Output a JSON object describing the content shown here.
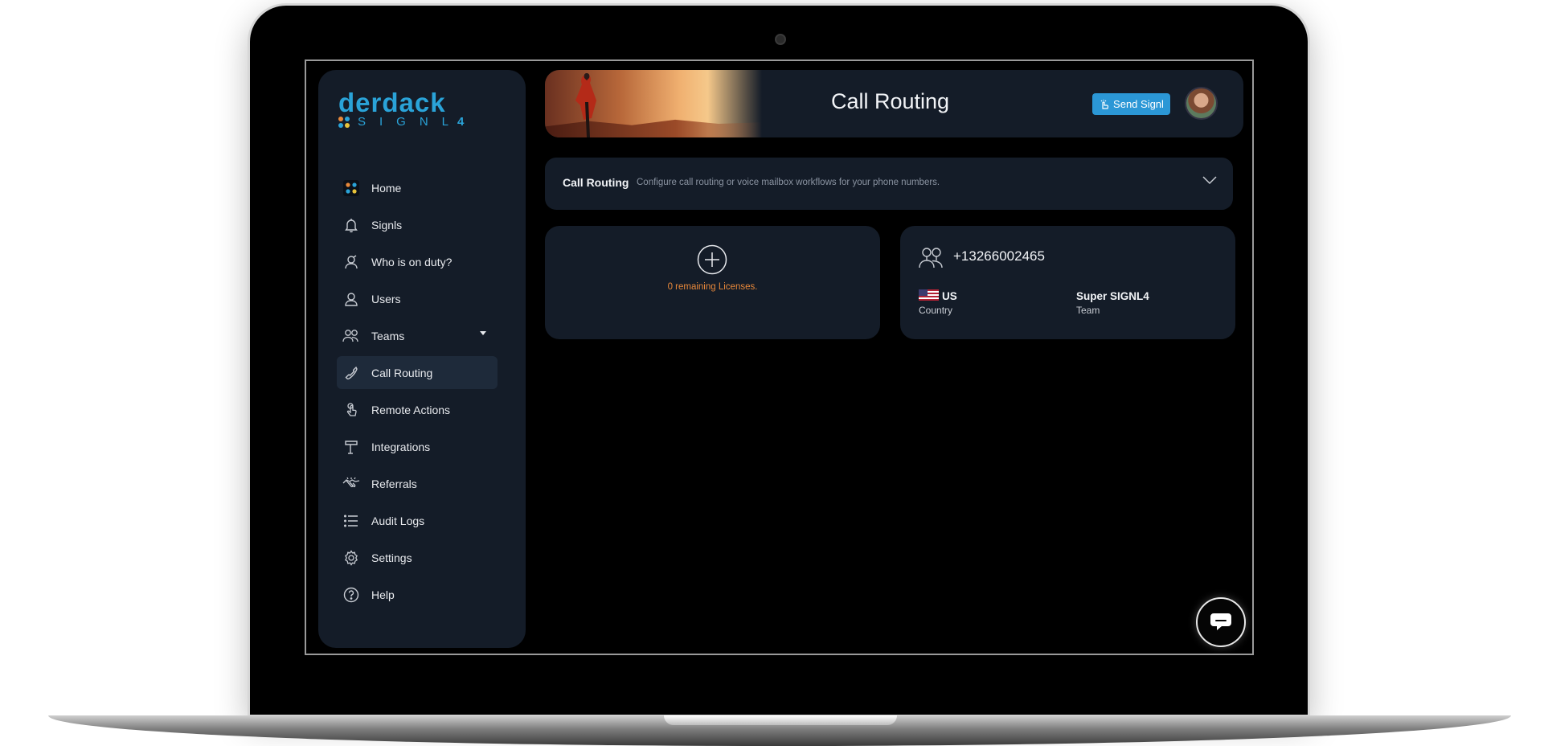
{
  "brand": {
    "word": "derdack",
    "sub": "SIGNL",
    "sub_num": "4"
  },
  "nav": [
    {
      "label": "Home",
      "icon": "home-grid-icon"
    },
    {
      "label": "Signls",
      "icon": "bell-icon"
    },
    {
      "label": "Who is on duty?",
      "icon": "duty-user-icon"
    },
    {
      "label": "Users",
      "icon": "user-icon"
    },
    {
      "label": "Teams",
      "icon": "team-icon",
      "has_dropdown": true
    },
    {
      "label": "Call Routing",
      "icon": "phone-icon",
      "active": true
    },
    {
      "label": "Remote Actions",
      "icon": "hand-touch-icon"
    },
    {
      "label": "Integrations",
      "icon": "signpost-icon"
    },
    {
      "label": "Referrals",
      "icon": "handshake-icon"
    },
    {
      "label": "Audit Logs",
      "icon": "list-icon"
    },
    {
      "label": "Settings",
      "icon": "gear-icon"
    },
    {
      "label": "Help",
      "icon": "help-circle-icon"
    }
  ],
  "header": {
    "title": "Call Routing",
    "send_button": "Send Signl"
  },
  "accordion": {
    "title": "Call Routing",
    "description": "Configure call routing or voice mailbox workflows for your phone numbers."
  },
  "add_card": {
    "licenses_text": "0 remaining Licenses."
  },
  "phone_card": {
    "number": "+13266002465",
    "country_value": "US",
    "country_label": "Country",
    "team_value": "Super SIGNL4",
    "team_label": "Team"
  },
  "colors": {
    "accent": "#2b97d6",
    "sidebar_bg": "#141c28",
    "warning_text": "#e8883a"
  }
}
